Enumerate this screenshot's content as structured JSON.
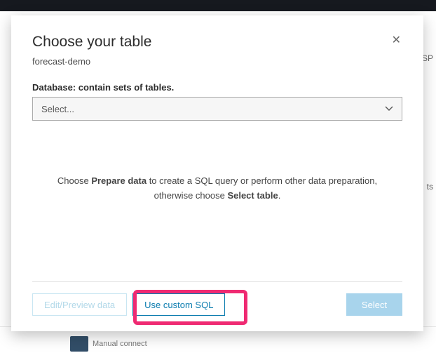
{
  "modal": {
    "title": "Choose your table",
    "subtitle": "forecast-demo",
    "database_label": "Database: contain sets of tables.",
    "select_placeholder": "Select...",
    "helper_prefix": "Choose ",
    "helper_bold1": "Prepare data",
    "helper_mid": " to create a SQL query or perform other data preparation, otherwise choose ",
    "helper_bold2": "Select table",
    "helper_suffix": "."
  },
  "buttons": {
    "edit_preview": "Edit/Preview data",
    "custom_sql": "Use custom SQL",
    "select": "Select"
  },
  "background": {
    "frag1": "SP",
    "frag2": "ts",
    "manual_connect": "Manual connect"
  }
}
